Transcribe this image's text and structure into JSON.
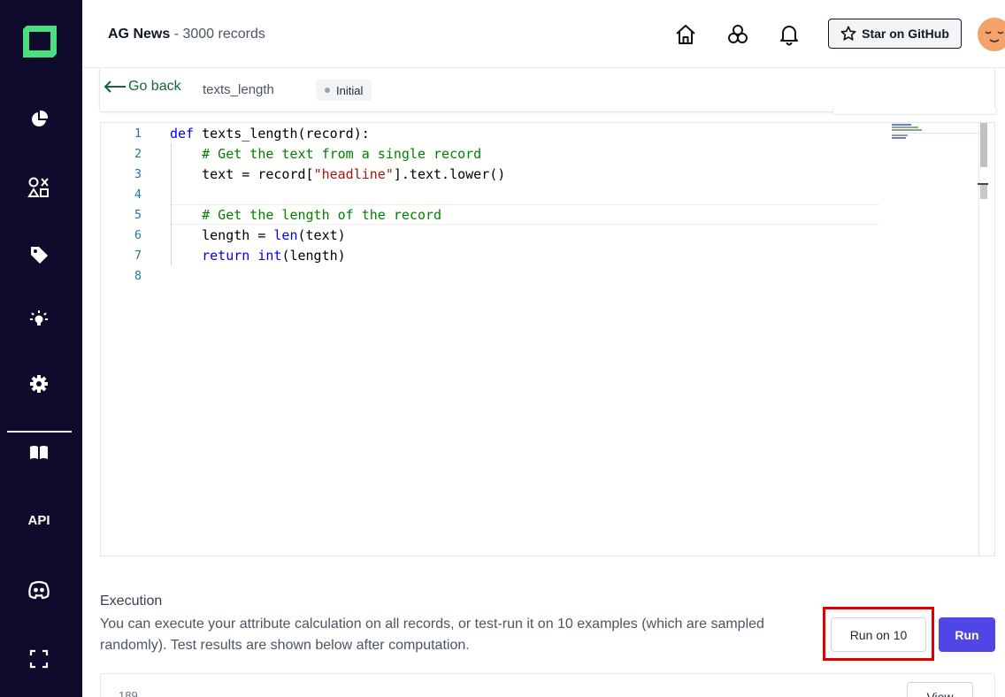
{
  "header": {
    "project_name": "AG News",
    "separator": "-",
    "record_count": "3000 records",
    "github_button": "Star on GitHub"
  },
  "sidebar": {
    "items": [
      {
        "icon": "pie-chart-icon"
      },
      {
        "icon": "shapes-icon"
      },
      {
        "icon": "tag-icon"
      },
      {
        "icon": "lightbulb-icon"
      },
      {
        "icon": "gear-icon"
      },
      {
        "icon": "book-icon"
      },
      {
        "label": "API"
      },
      {
        "icon": "discord-icon"
      },
      {
        "icon": "fullscreen-icon"
      }
    ]
  },
  "subheader": {
    "go_back": "Go back",
    "attribute_name": "texts_length",
    "state": "Initial"
  },
  "editor": {
    "line_numbers": [
      "1",
      "2",
      "3",
      "4",
      "5",
      "6",
      "7",
      "8"
    ]
  },
  "execution": {
    "title": "Execution",
    "description": "You can execute your attribute calculation on all records, or test-run it on 10 examples (which are sampled randomly). Test results are shown below after computation.",
    "run_on_10_label": "Run on 10",
    "run_label": "Run"
  },
  "result": {
    "value": "189",
    "view_label": "View"
  },
  "colors": {
    "sidebar_bg": "#0f0b2c",
    "logo_green": "#4ade80",
    "run_button": "#4f46e5",
    "highlight": "#e00000",
    "go_back": "#166534"
  }
}
